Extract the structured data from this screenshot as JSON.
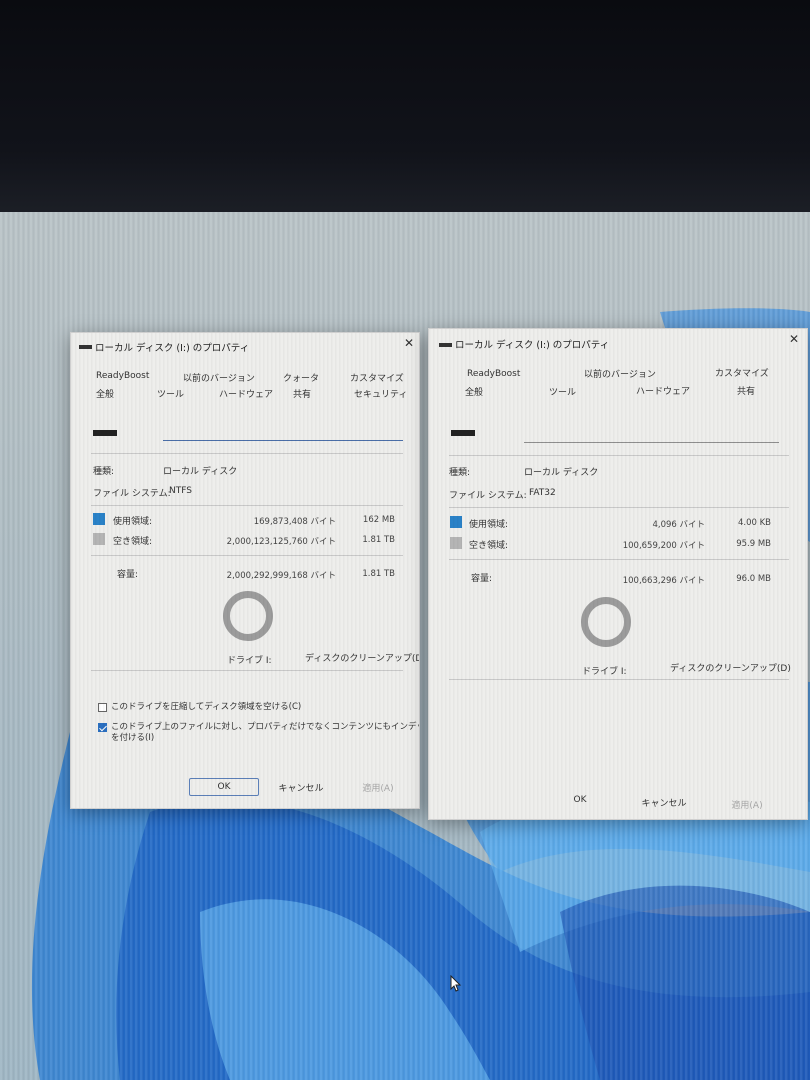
{
  "dialogs": [
    {
      "title": "ローカル ディスク (I:) のプロパティ",
      "tabs_row1": [
        "ReadyBoost",
        "以前のバージョン",
        "クォータ",
        "カスタマイズ"
      ],
      "tabs_row2": [
        "全般",
        "ツール",
        "ハードウェア",
        "共有",
        "セキュリティ"
      ],
      "name_value": "",
      "type_label": "種類:",
      "type_value": "ローカル ディスク",
      "fs_label": "ファイル システム:",
      "fs_value": "NTFS",
      "used_label": "使用領域:",
      "used_bytes": "169,873,408 バイト",
      "used_size": "162 MB",
      "free_label": "空き領域:",
      "free_bytes": "2,000,123,125,760 バイト",
      "free_size": "1.81 TB",
      "cap_label": "容量:",
      "cap_bytes": "2,000,292,999,168 バイト",
      "cap_size": "1.81 TB",
      "used_fraction": 0.0001,
      "drive_label": "ドライブ I:",
      "cleanup": "ディスクのクリーンアップ(D)",
      "compress_label": "このドライブを圧縮してディスク領域を空ける(C)",
      "compress_checked": false,
      "index_label_1": "このドライブ上のファイルに対し、プロパティだけでなくコンテンツにもインデックス",
      "index_label_2": "を付ける(I)",
      "index_checked": true,
      "ok": "OK",
      "cancel": "キャンセル",
      "apply": "適用(A)"
    },
    {
      "title": "ローカル ディスク (I:) のプロパティ",
      "tabs_row1": [
        "ReadyBoost",
        "以前のバージョン",
        "カスタマイズ"
      ],
      "tabs_row2": [
        "全般",
        "ツール",
        "ハードウェア",
        "共有"
      ],
      "name_value": "",
      "type_label": "種類:",
      "type_value": "ローカル ディスク",
      "fs_label": "ファイル システム:",
      "fs_value": "FAT32",
      "used_label": "使用領域:",
      "used_bytes": "4,096 バイト",
      "used_size": "4.00 KB",
      "free_label": "空き領域:",
      "free_bytes": "100,659,200 バイト",
      "free_size": "95.9 MB",
      "cap_label": "容量:",
      "cap_bytes": "100,663,296 バイト",
      "cap_size": "96.0 MB",
      "used_fraction": 4e-05,
      "drive_label": "ドライブ I:",
      "cleanup": "ディスクのクリーンアップ(D)",
      "ok": "OK",
      "cancel": "キャンセル",
      "apply": "適用(A)"
    }
  ],
  "colors": {
    "used": "#2a82c8",
    "free": "#b5b5b5",
    "accent": "#4b6fa8"
  }
}
